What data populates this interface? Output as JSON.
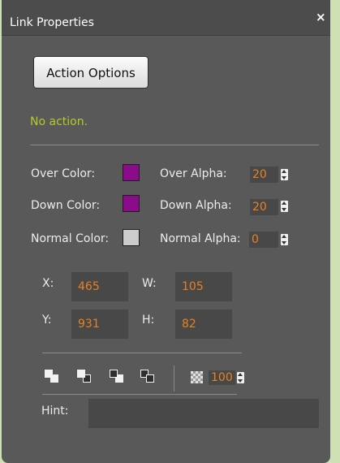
{
  "window": {
    "title": "Link Properties",
    "close_glyph": "×"
  },
  "action_button": {
    "label": "Action Options"
  },
  "status_text": "No action.",
  "colors": {
    "accent_value": "#e8811f",
    "status": "#b6c826",
    "over_color": "#8a0c8a",
    "down_color": "#8a0c8a",
    "normal_color": "#cccccc"
  },
  "color_rows": [
    {
      "color_label": "Over Color:",
      "alpha_label": "Over Alpha:",
      "alpha_value": "20"
    },
    {
      "color_label": "Down Color:",
      "alpha_label": "Down Alpha:",
      "alpha_value": "20"
    },
    {
      "color_label": "Normal Color:",
      "alpha_label": "Normal Alpha:",
      "alpha_value": "0"
    }
  ],
  "geometry_fields": {
    "x": {
      "label": "X:",
      "value": "465"
    },
    "w": {
      "label": "W:",
      "value": "105"
    },
    "y": {
      "label": "Y:",
      "value": "931"
    },
    "h": {
      "label": "H:",
      "value": "82"
    }
  },
  "toolbar": {
    "icons": [
      "bring-to-front-icon",
      "send-to-back-icon",
      "bring-forward-icon",
      "send-backward-icon",
      "transparency-icon"
    ],
    "opacity_value": "100"
  },
  "hint": {
    "label": "Hint:",
    "value": ""
  }
}
